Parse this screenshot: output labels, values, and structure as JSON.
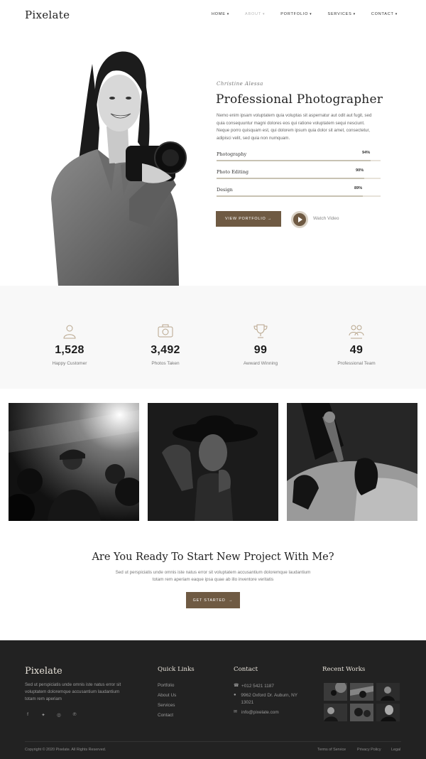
{
  "header": {
    "logo": "Pixelate",
    "nav": [
      {
        "label": "HOME",
        "active": false
      },
      {
        "label": "ABOUT",
        "active": true
      },
      {
        "label": "PORTFOLIO",
        "active": false
      },
      {
        "label": "SERVICES",
        "active": false
      },
      {
        "label": "CONTACT",
        "active": false
      }
    ]
  },
  "hero": {
    "signature": "Christine Alessa",
    "title": "Professional Photographer",
    "description": "Nemo enim ipsam voluptatem quia voluptas sit aspernatur aut odit aut fugit, sed quia consequuntur magni dolores eos qui ratione voluptatem sequi nesciunt. Neque porro quisquam est, qui dolorem ipsum quia dolor sit amet, consectetur, adipisci velit, sed quia non numquam.",
    "skills": [
      {
        "label": "Photography",
        "percent_label": "94%",
        "value": 0.94
      },
      {
        "label": "Photo Editing",
        "percent_label": "90%",
        "value": 0.9
      },
      {
        "label": "Design",
        "percent_label": "89%",
        "value": 0.89
      }
    ],
    "portfolio_button": "VIEW PORTFOLIO",
    "watch_video": "Watch Video"
  },
  "stats": [
    {
      "icon": "user-icon",
      "number": "1,528",
      "label": "Happy Customer"
    },
    {
      "icon": "camera-icon",
      "number": "3,492",
      "label": "Photos Taken"
    },
    {
      "icon": "trophy-icon",
      "number": "99",
      "label": "Awward Winning"
    },
    {
      "icon": "team-icon",
      "number": "49",
      "label": "Professional Team"
    }
  ],
  "cta": {
    "title": "Are You Ready To Start New Project With Me?",
    "description": "Sed ut perspiciatis unde omnis iste natus error sit voluptatem accusantium doloremque laudantium totam rem aperiam eaque ipsa quae ab illo inventore veritatis",
    "button": "GET STARTED"
  },
  "footer": {
    "logo": "Pixelate",
    "about": "Sed ut perspiciatis unde omnis iste natus error sit voluptatem doloremque accusantium laudantium totam rem aperiam",
    "social": [
      "facebook-icon",
      "twitter-icon",
      "instagram-icon",
      "pinterest-icon"
    ],
    "quick_links_title": "Quick Links",
    "quick_links": [
      "Portfolio",
      "About Us",
      "Services",
      "Contact"
    ],
    "contact_title": "Contact",
    "contact_phone": "+012 5421 1187",
    "contact_address": "9962 Oxford Dr. Auburn, NY 13021",
    "contact_email": "info@pixelate.com",
    "recent_title": "Recent Works",
    "copyright": "Copyright © 2020 Pixelate. All Rights Reserved.",
    "legal_links": [
      "Terms of Service",
      "Privacy Policy",
      "Legal"
    ]
  }
}
